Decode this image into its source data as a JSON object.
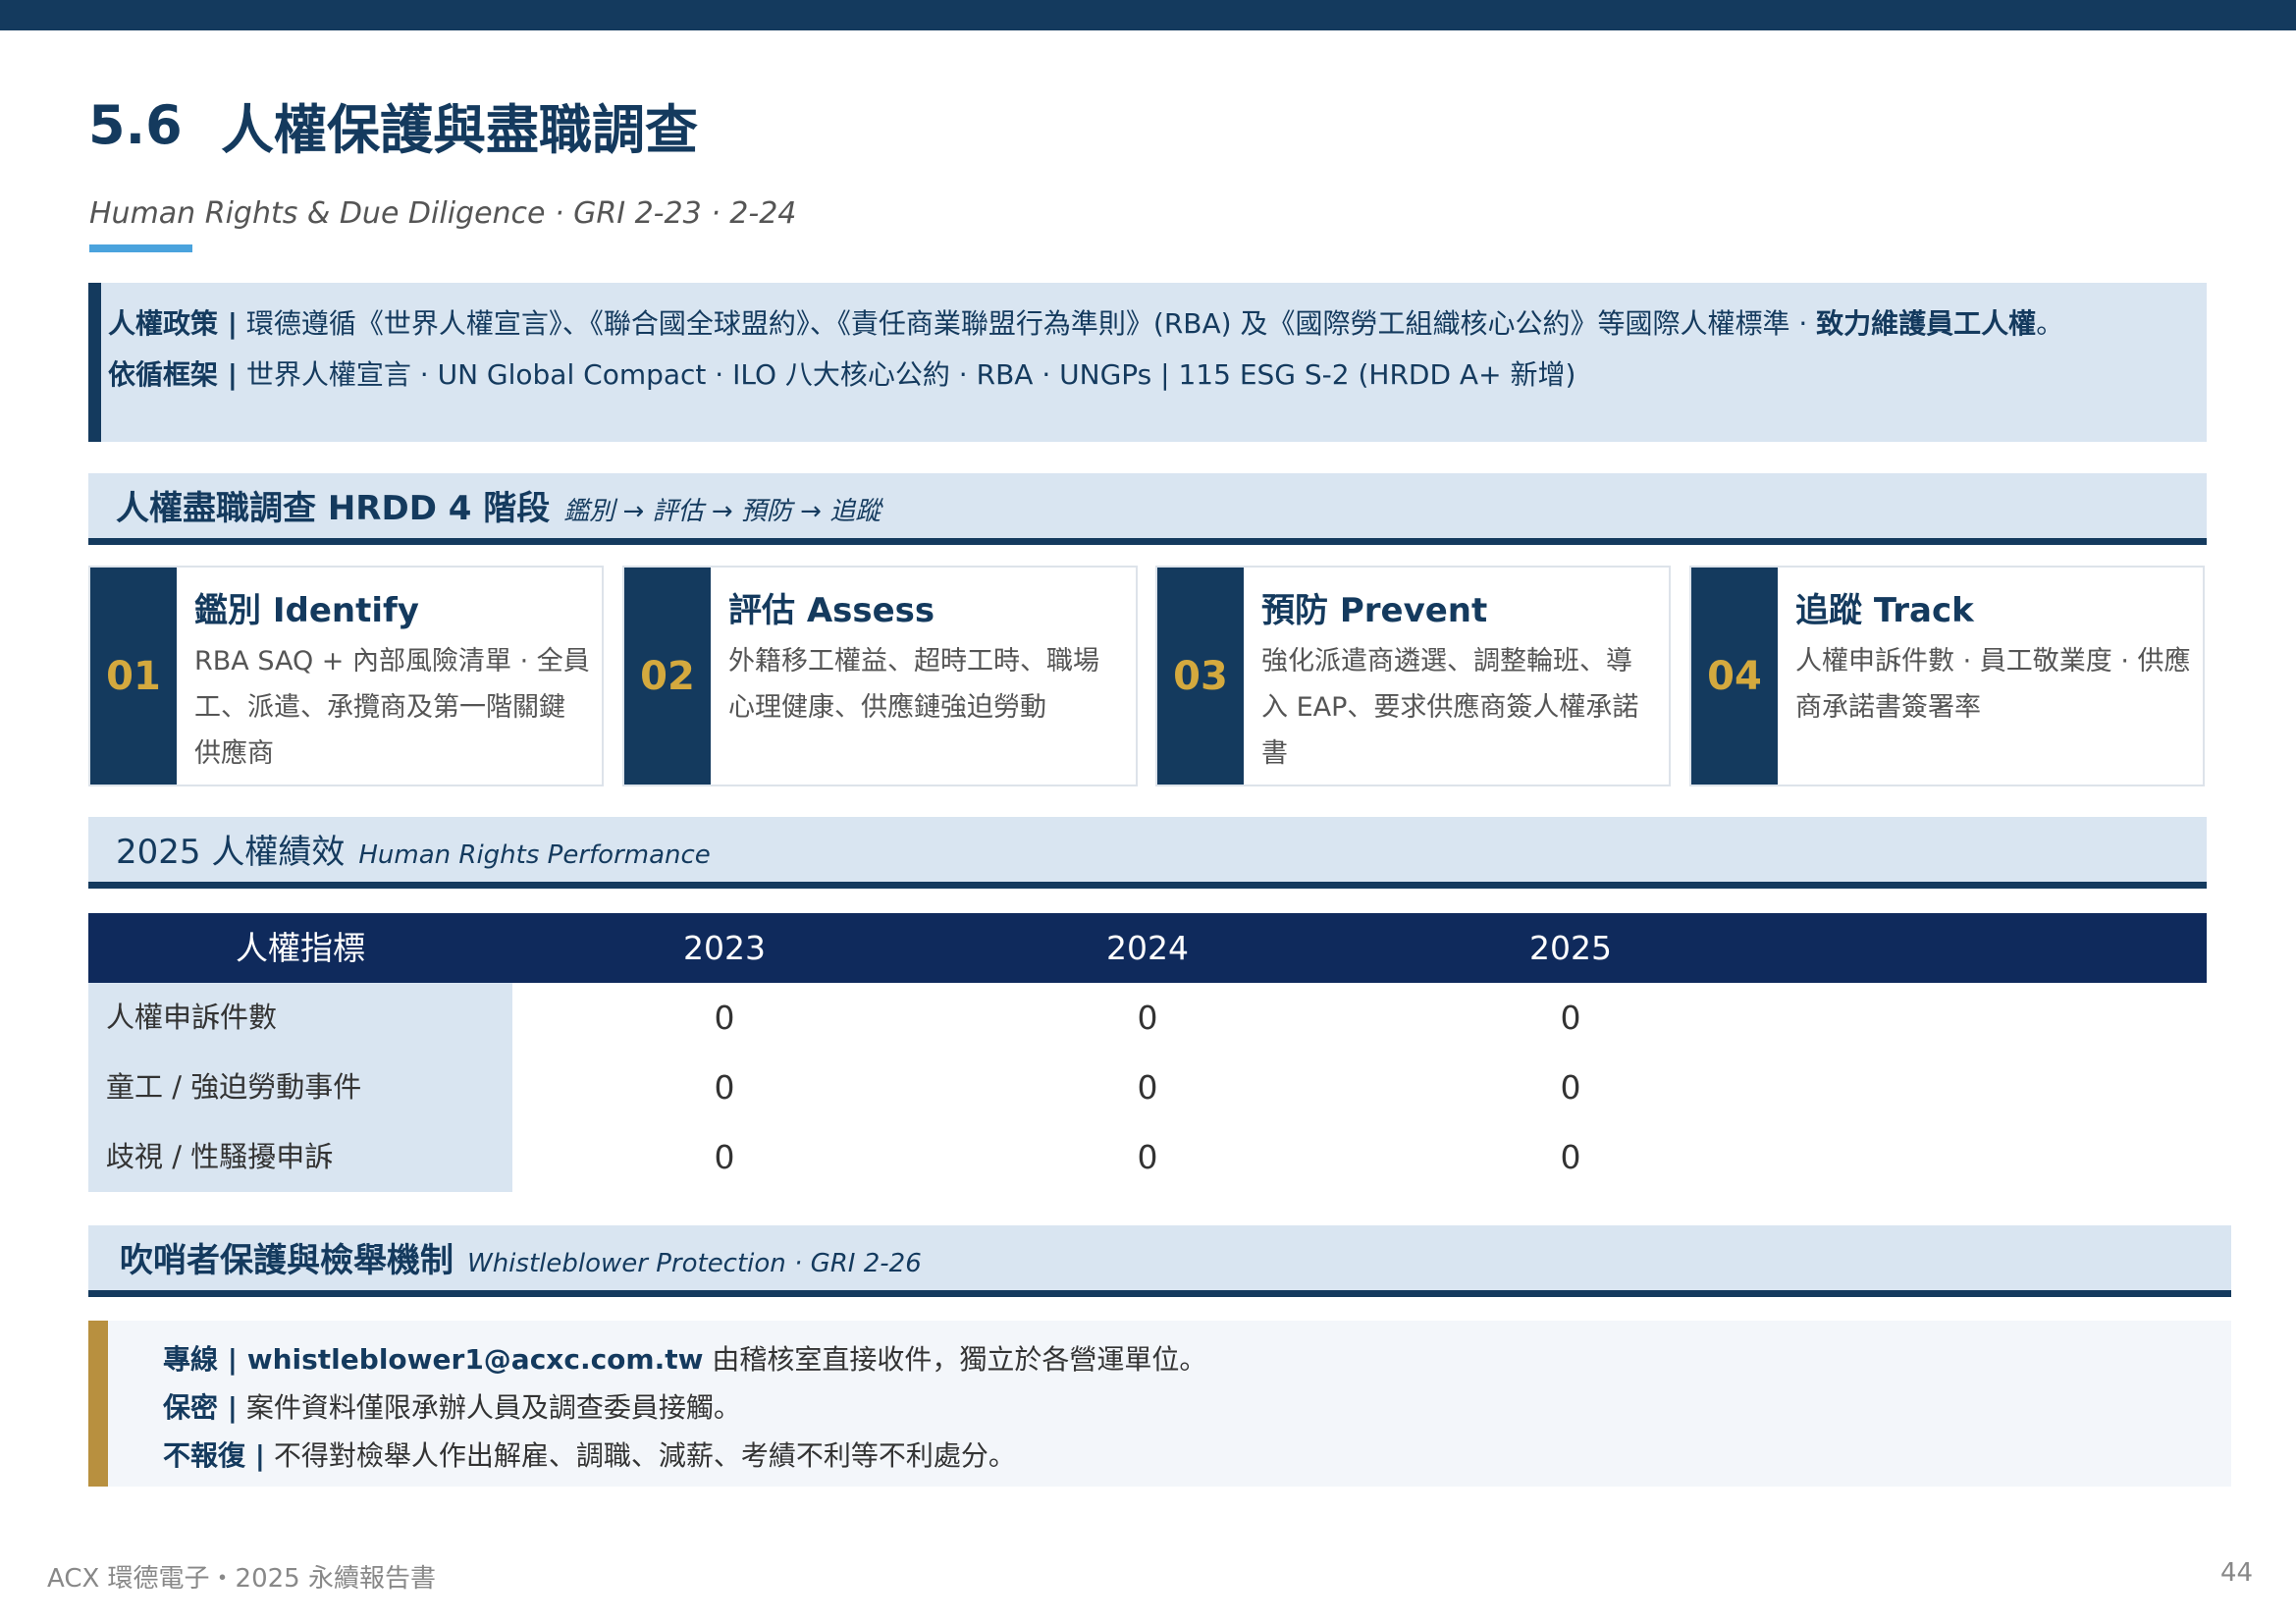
{
  "header": {
    "section_number": "5.6",
    "title": "人權保護與盡職調查",
    "subtitle": "Human Rights & Due Diligence · GRI  2-23 ·  2-24"
  },
  "policy": {
    "label1": "人權政策 |",
    "text1": " 環德遵循《世界人權宣言》、《聯合國全球盟約》、《責任商業聯盟行為準則》(RBA) 及《國際勞工組織核心公約》等國際人權標準 · ",
    "emph1": "致力維護員工人權",
    "end1": "。",
    "label2": "依循框架 |",
    "text2": " 世界人權宣言 · UN Global Compact · ILO 八大核心公約 · RBA · UNGPs   |   115 ESG S-2 (HRDD A+ 新增)"
  },
  "hrdd_section": {
    "title": "人權盡職調查 HRDD 4 階段",
    "note": "鑑別 → 評估 → 預防 → 追蹤"
  },
  "steps": [
    {
      "num": "01",
      "title": "鑑別 Identify",
      "desc": "RBA SAQ + 內部風險清單 · 全員工、派遣、承攬商及第一階關鍵供應商"
    },
    {
      "num": "02",
      "title": "評估 Assess",
      "desc": "外籍移工權益、超時工時、職場心理健康、供應鏈強迫勞動"
    },
    {
      "num": "03",
      "title": "預防 Prevent",
      "desc": "強化派遣商遴選、調整輪班、導入 EAP、要求供應商簽人權承諾書"
    },
    {
      "num": "04",
      "title": "追蹤 Track",
      "desc": "人權申訴件數 · 員工敬業度 · 供應商承諾書簽署率"
    }
  ],
  "performance_section": {
    "title": "2025 人權績效",
    "note": "Human Rights Performance"
  },
  "table": {
    "headers": [
      "人權指標",
      "2023",
      "2024",
      "2025"
    ],
    "rows": [
      {
        "label": "人權申訴件數",
        "values": [
          "0",
          "0",
          "0"
        ]
      },
      {
        "label": "童工 / 強迫勞動事件",
        "values": [
          "0",
          "0",
          "0"
        ]
      },
      {
        "label": "歧視 / 性騷擾申訴",
        "values": [
          "0",
          "0",
          "0"
        ]
      }
    ]
  },
  "whistle_section": {
    "title": "吹哨者保護與檢舉機制",
    "note": "Whistleblower Protection · GRI 2-26"
  },
  "whistle": [
    {
      "label": "專線 |",
      "emph": " whistleblower1@acxc.com.tw",
      "text": " 由稽核室直接收件，獨立於各營運單位。"
    },
    {
      "label": "保密 |",
      "emph": "",
      "text": " 案件資料僅限承辦人員及調查委員接觸。"
    },
    {
      "label": "不報復 |",
      "emph": "",
      "text": " 不得對檢舉人作出解雇、調職、減薪、考績不利等不利處分。"
    }
  ],
  "footer": {
    "left": "ACX 環德電子・2025 永續報告書",
    "page": "44"
  },
  "colors": {
    "navy": "#143a5e",
    "table_header": "#0f2a5c",
    "light_blue": "#d9e5f1",
    "gold": "#d4a93e",
    "accent_blue": "#4aa3dd",
    "gold_bar": "#b8903f"
  }
}
